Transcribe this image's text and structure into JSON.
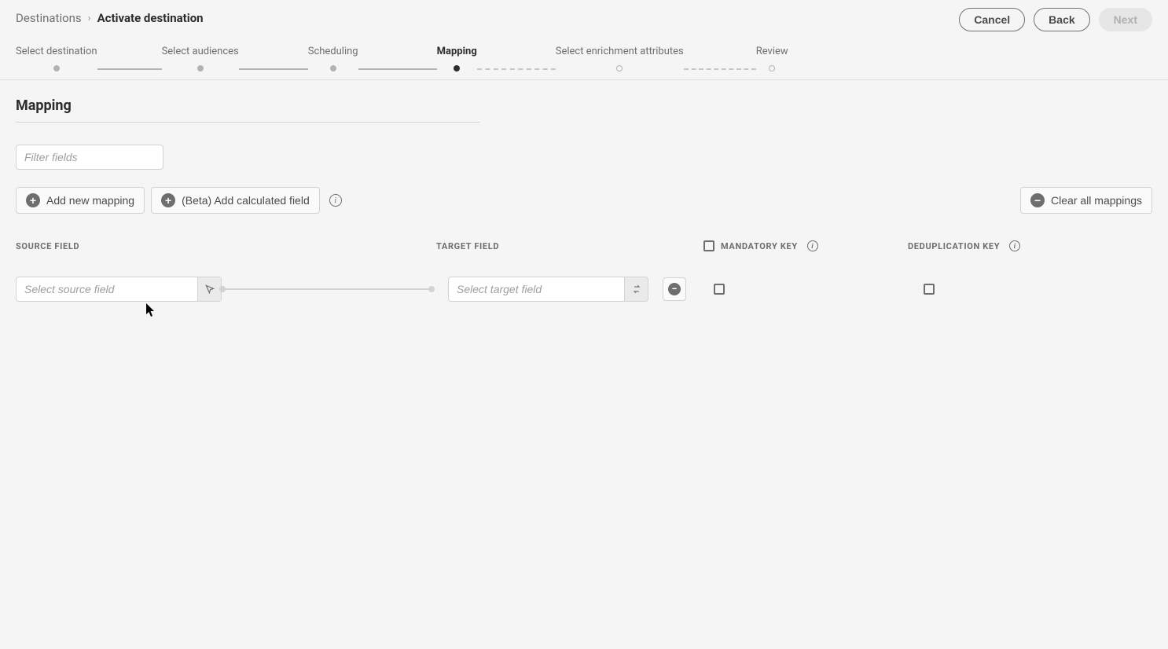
{
  "breadcrumb": {
    "root": "Destinations",
    "current": "Activate destination"
  },
  "actions": {
    "cancel": "Cancel",
    "back": "Back",
    "next": "Next"
  },
  "steps": [
    {
      "label": "Select destination"
    },
    {
      "label": "Select audiences"
    },
    {
      "label": "Scheduling"
    },
    {
      "label": "Mapping"
    },
    {
      "label": "Select enrichment attributes"
    },
    {
      "label": "Review"
    }
  ],
  "page": {
    "title": "Mapping",
    "filter_placeholder": "Filter fields"
  },
  "toolbar": {
    "add_mapping": "Add new mapping",
    "add_calc": "(Beta) Add calculated field",
    "clear": "Clear all mappings"
  },
  "columns": {
    "source": "SOURCE FIELD",
    "target": "TARGET FIELD",
    "mandatory": "MANDATORY KEY",
    "dedup": "DEDUPLICATION KEY"
  },
  "row": {
    "source_placeholder": "Select source field",
    "target_placeholder": "Select target field"
  }
}
